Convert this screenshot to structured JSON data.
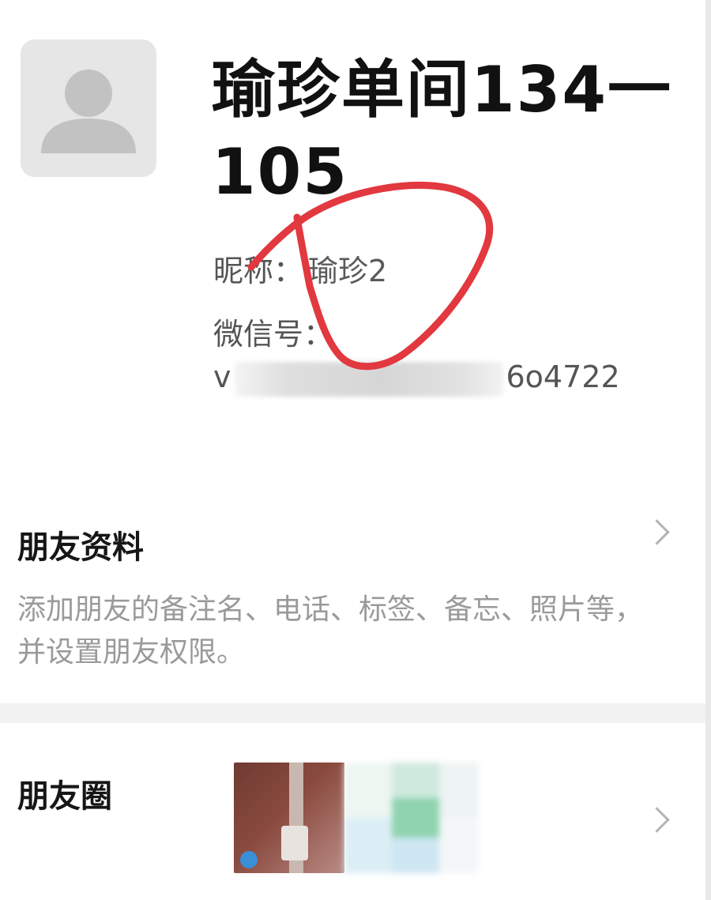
{
  "profile": {
    "name": "瑜珍单间134一105",
    "nickname_label": "昵称：",
    "nickname_value": "瑜珍2",
    "wechat_id_label": "微信号：",
    "wechat_id_prefix": "v",
    "wechat_id_suffix": "6o4722"
  },
  "friend_info": {
    "title": "朋友资料",
    "description": "添加朋友的备注名、电话、标签、备忘、照片等，并设置朋友权限。"
  },
  "moments": {
    "title": "朋友圈"
  },
  "icons": {
    "avatar": "default-avatar-icon",
    "chevron": "chevron-right-icon"
  },
  "colors": {
    "annotation": "#e2383f",
    "page_background": "#ffffff",
    "title_text": "#111111",
    "muted_text": "#9a9a9a"
  }
}
